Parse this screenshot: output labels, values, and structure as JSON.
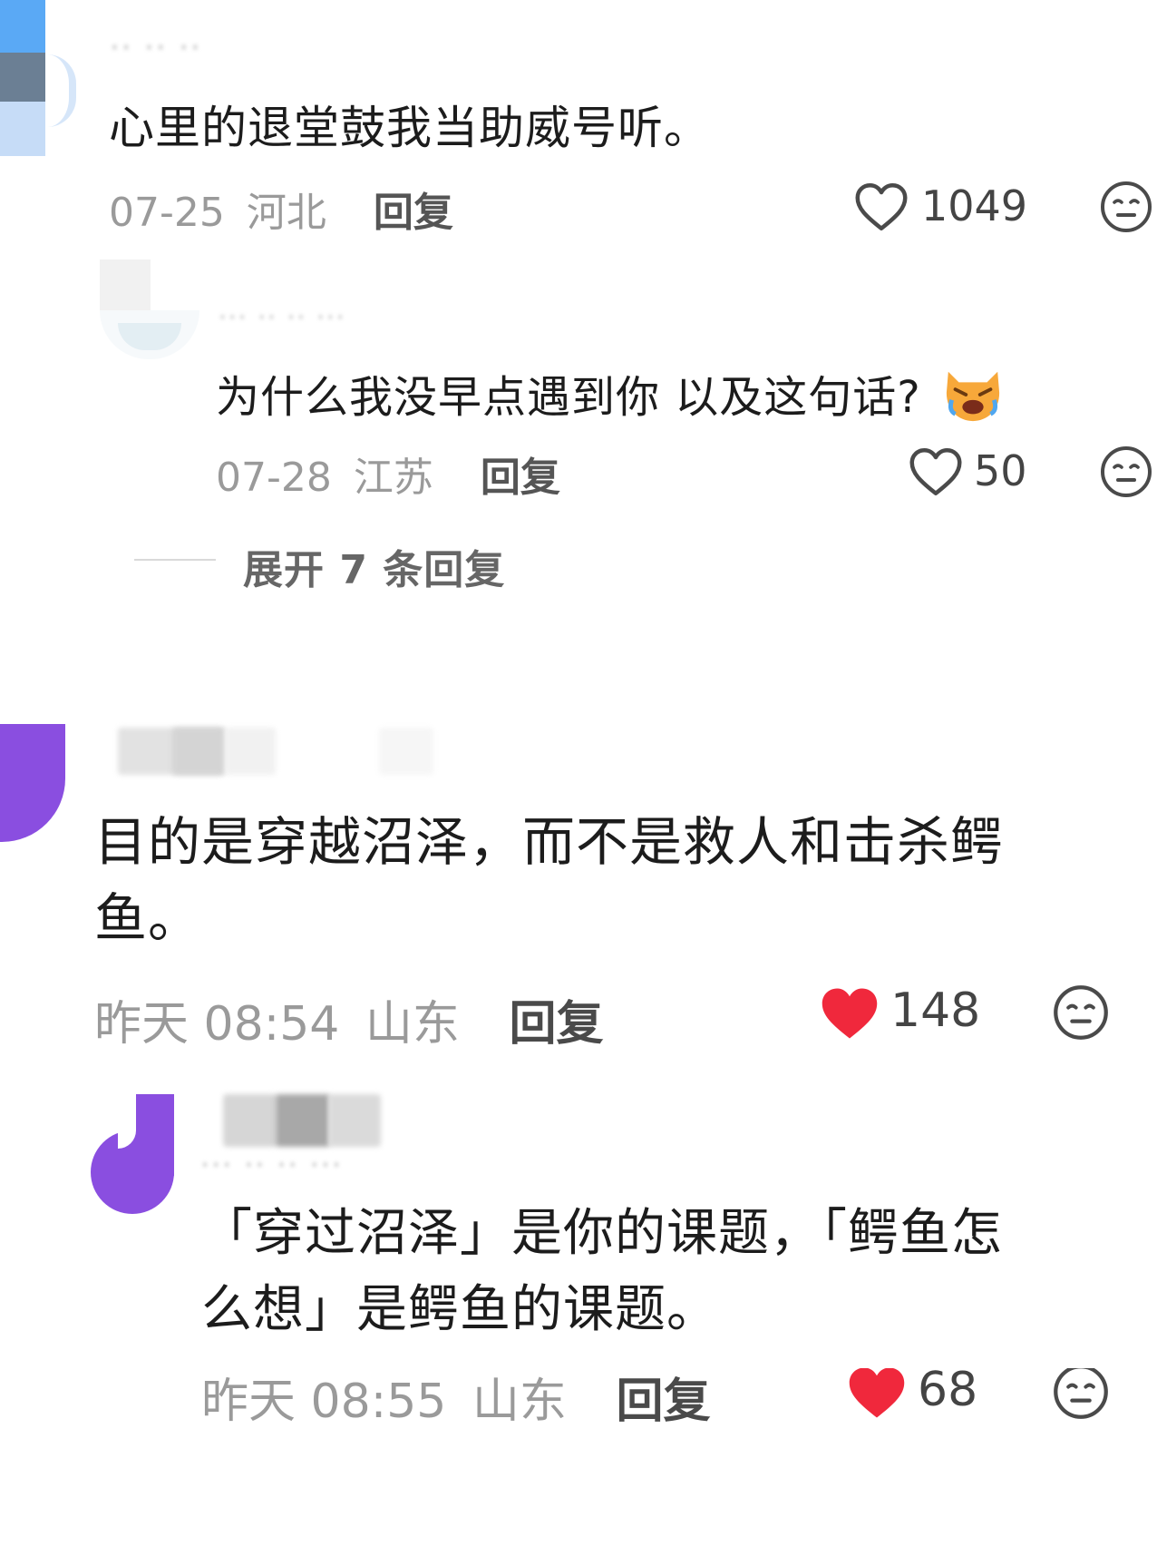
{
  "comments": [
    {
      "text": "心里的退堂鼓我当助威号听。",
      "date": "07-25",
      "region": "河北",
      "reply_label": "回复",
      "likes": "1049",
      "liked": false
    },
    {
      "text": "为什么我没早点遇到你 以及这句话?",
      "date": "07-28",
      "region": "江苏",
      "reply_label": "回复",
      "likes": "50",
      "liked": false
    },
    {
      "text_line1": "目的是穿越沼泽，而不是救人和击杀鳄",
      "text_line2": "鱼。",
      "time": "昨天 08:54",
      "region": "山东",
      "reply_label": "回复",
      "likes": "148",
      "liked": true
    },
    {
      "text_line1": "「穿过沼泽」是你的课题，「鳄鱼怎",
      "text_line2": "么想」是鳄鱼的课题。",
      "time": "昨天 08:55",
      "region": "山东",
      "reply_label": "回复",
      "likes": "68",
      "liked": true
    }
  ],
  "expand_replies": "展开 7 条回复",
  "colors": {
    "liked_heart": "#f0283c",
    "meta_gray": "#9a9a9a",
    "avatar_purple": "#8a4ee0",
    "avatar_blue": "#5aa9f5"
  },
  "icons": [
    "heart-outline-icon",
    "heart-filled-icon",
    "meh-face-icon",
    "crying-cat-emoji"
  ]
}
